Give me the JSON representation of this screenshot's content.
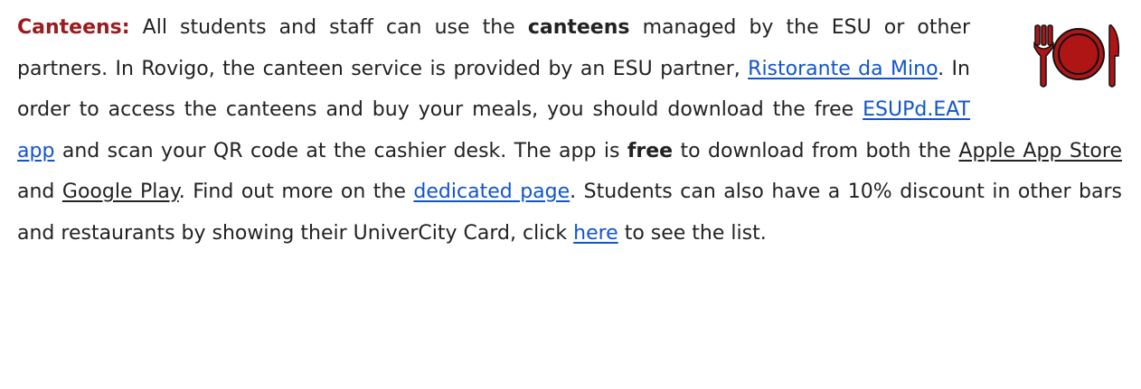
{
  "paragraph": {
    "heading": "Canteens:",
    "t1": " All students and staff can use the ",
    "b1": "canteens",
    "t2": " managed by the ESU or other partners. In Rovigo, the canteen service is provided by an ESU partner, ",
    "link_ristorante": "Ristorante da Mino",
    "t3": ". In order to access the canteens and buy your meals, you should download the free ",
    "link_app": "ESUPd.EAT app",
    "t4": " and scan your QR code at the cashier desk. The app is ",
    "b2": "free",
    "t5": " to download from both the ",
    "link_apple": "Apple App Store",
    "t6": " and ",
    "link_google": "Google Play",
    "t7": ". Find out more on the ",
    "link_dedicated": "dedicated page",
    "t8": ". Students can also have a 10% discount in other bars and restaurants by showing their UniverCity Card, click ",
    "link_here": "here",
    "t9": " to see the list."
  },
  "icon": {
    "name": "plate-fork-knife-icon",
    "color": "#b01516",
    "outline": "#111111"
  },
  "colors": {
    "heading": "#9b1b1e",
    "link": "#1155cc",
    "text": "#222222"
  }
}
